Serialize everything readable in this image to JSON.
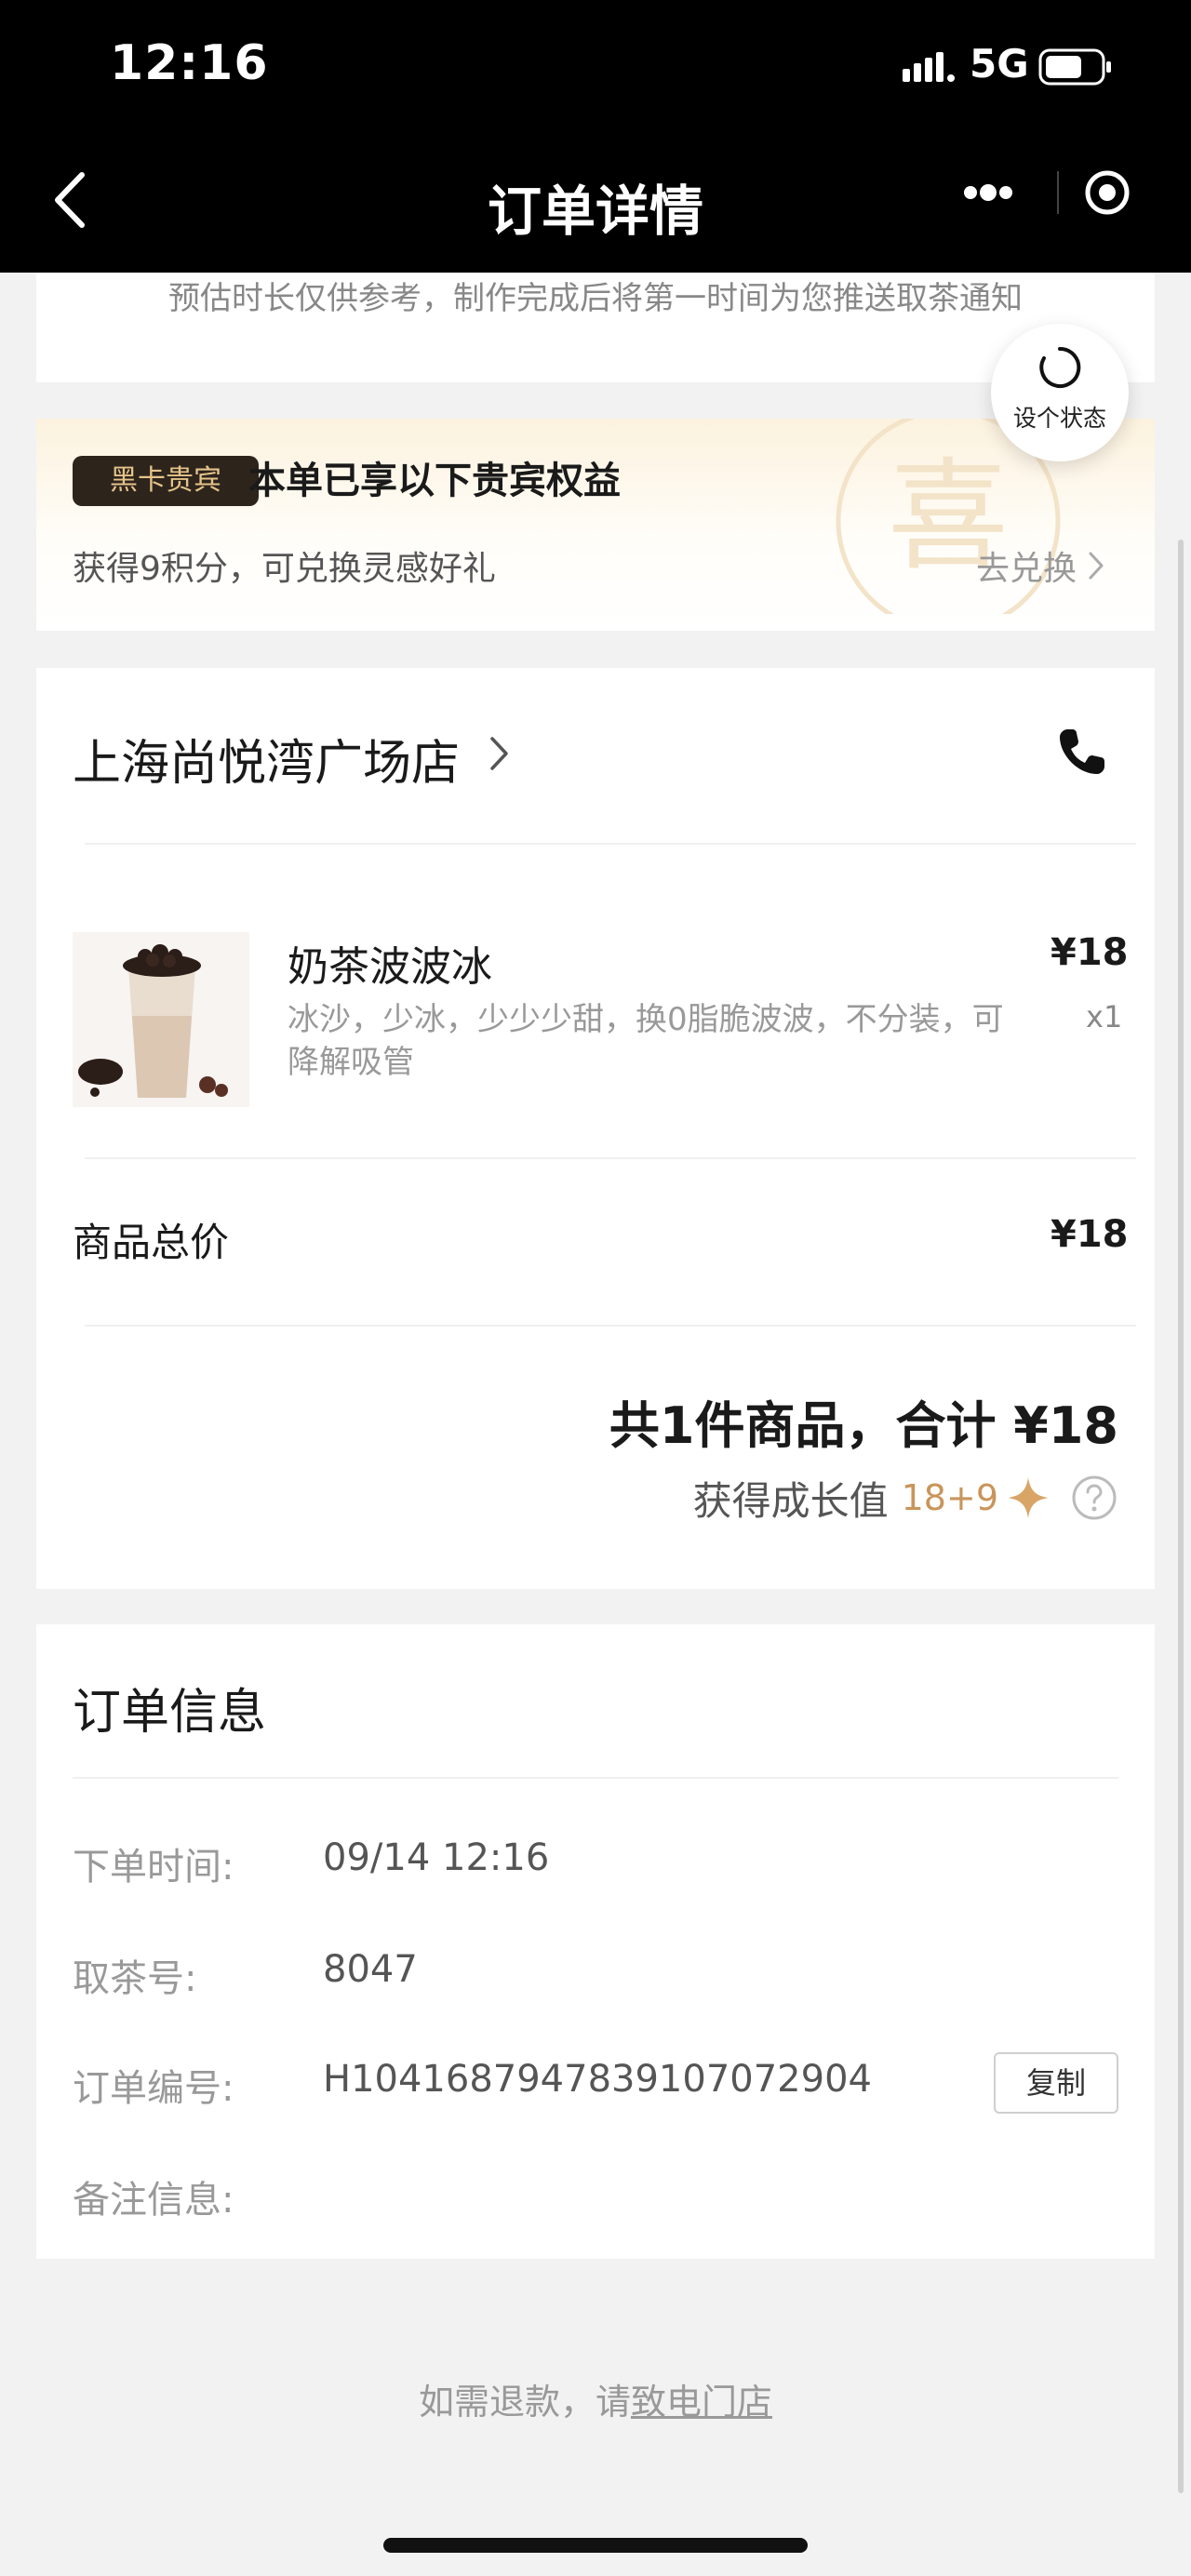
{
  "status_bar": {
    "time": "12:16",
    "network": "5G"
  },
  "nav": {
    "title": "订单详情"
  },
  "eta": {
    "note": "预估时长仅供参考，制作完成后将第一时间为您推送取茶通知"
  },
  "status_button": {
    "label": "设个状态"
  },
  "vip": {
    "badge": "黑卡贵宾",
    "title": "本单已享以下贵宾权益",
    "points_text": "获得9积分，可兑换灵感好礼",
    "redeem_label": "去兑换",
    "watermark_char": "喜"
  },
  "order": {
    "store_name": "上海尚悦湾广场店",
    "product": {
      "name": "奶茶波波冰",
      "options": "冰沙，少冰，少少少甜，换0脂脆波波，不分装，可降解吸管",
      "price": "¥18",
      "qty": "x1"
    },
    "subtotal_label": "商品总价",
    "subtotal_value": "¥18",
    "total_text": "共1件商品，合计 ¥18",
    "growth_label": "获得成长值",
    "growth_value": "18+9"
  },
  "order_info": {
    "title": "订单信息",
    "rows": [
      {
        "label": "下单时间:",
        "value": "09/14 12:16"
      },
      {
        "label": "取茶号:",
        "value": "8047"
      },
      {
        "label": "订单编号:",
        "value": "H1041687947839107072904"
      },
      {
        "label": "备注信息:",
        "value": ""
      }
    ],
    "copy_label": "复制"
  },
  "footer": {
    "refund_prefix": "如需退款，请",
    "refund_link": "致电门店"
  },
  "colors": {
    "nav_bg": "#000000",
    "accent_gold": "#c9955b",
    "badge_bg": "#2d241c",
    "badge_text": "#e5c48a"
  }
}
